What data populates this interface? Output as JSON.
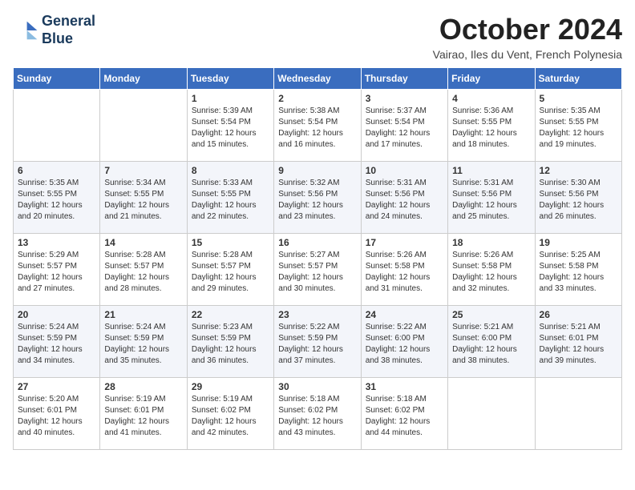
{
  "header": {
    "logo_line1": "General",
    "logo_line2": "Blue",
    "month": "October 2024",
    "location": "Vairao, Iles du Vent, French Polynesia"
  },
  "weekdays": [
    "Sunday",
    "Monday",
    "Tuesday",
    "Wednesday",
    "Thursday",
    "Friday",
    "Saturday"
  ],
  "weeks": [
    [
      {
        "day": "",
        "sunrise": "",
        "sunset": "",
        "daylight": ""
      },
      {
        "day": "",
        "sunrise": "",
        "sunset": "",
        "daylight": ""
      },
      {
        "day": "1",
        "sunrise": "Sunrise: 5:39 AM",
        "sunset": "Sunset: 5:54 PM",
        "daylight": "Daylight: 12 hours and 15 minutes."
      },
      {
        "day": "2",
        "sunrise": "Sunrise: 5:38 AM",
        "sunset": "Sunset: 5:54 PM",
        "daylight": "Daylight: 12 hours and 16 minutes."
      },
      {
        "day": "3",
        "sunrise": "Sunrise: 5:37 AM",
        "sunset": "Sunset: 5:54 PM",
        "daylight": "Daylight: 12 hours and 17 minutes."
      },
      {
        "day": "4",
        "sunrise": "Sunrise: 5:36 AM",
        "sunset": "Sunset: 5:55 PM",
        "daylight": "Daylight: 12 hours and 18 minutes."
      },
      {
        "day": "5",
        "sunrise": "Sunrise: 5:35 AM",
        "sunset": "Sunset: 5:55 PM",
        "daylight": "Daylight: 12 hours and 19 minutes."
      }
    ],
    [
      {
        "day": "6",
        "sunrise": "Sunrise: 5:35 AM",
        "sunset": "Sunset: 5:55 PM",
        "daylight": "Daylight: 12 hours and 20 minutes."
      },
      {
        "day": "7",
        "sunrise": "Sunrise: 5:34 AM",
        "sunset": "Sunset: 5:55 PM",
        "daylight": "Daylight: 12 hours and 21 minutes."
      },
      {
        "day": "8",
        "sunrise": "Sunrise: 5:33 AM",
        "sunset": "Sunset: 5:55 PM",
        "daylight": "Daylight: 12 hours and 22 minutes."
      },
      {
        "day": "9",
        "sunrise": "Sunrise: 5:32 AM",
        "sunset": "Sunset: 5:56 PM",
        "daylight": "Daylight: 12 hours and 23 minutes."
      },
      {
        "day": "10",
        "sunrise": "Sunrise: 5:31 AM",
        "sunset": "Sunset: 5:56 PM",
        "daylight": "Daylight: 12 hours and 24 minutes."
      },
      {
        "day": "11",
        "sunrise": "Sunrise: 5:31 AM",
        "sunset": "Sunset: 5:56 PM",
        "daylight": "Daylight: 12 hours and 25 minutes."
      },
      {
        "day": "12",
        "sunrise": "Sunrise: 5:30 AM",
        "sunset": "Sunset: 5:56 PM",
        "daylight": "Daylight: 12 hours and 26 minutes."
      }
    ],
    [
      {
        "day": "13",
        "sunrise": "Sunrise: 5:29 AM",
        "sunset": "Sunset: 5:57 PM",
        "daylight": "Daylight: 12 hours and 27 minutes."
      },
      {
        "day": "14",
        "sunrise": "Sunrise: 5:28 AM",
        "sunset": "Sunset: 5:57 PM",
        "daylight": "Daylight: 12 hours and 28 minutes."
      },
      {
        "day": "15",
        "sunrise": "Sunrise: 5:28 AM",
        "sunset": "Sunset: 5:57 PM",
        "daylight": "Daylight: 12 hours and 29 minutes."
      },
      {
        "day": "16",
        "sunrise": "Sunrise: 5:27 AM",
        "sunset": "Sunset: 5:57 PM",
        "daylight": "Daylight: 12 hours and 30 minutes."
      },
      {
        "day": "17",
        "sunrise": "Sunrise: 5:26 AM",
        "sunset": "Sunset: 5:58 PM",
        "daylight": "Daylight: 12 hours and 31 minutes."
      },
      {
        "day": "18",
        "sunrise": "Sunrise: 5:26 AM",
        "sunset": "Sunset: 5:58 PM",
        "daylight": "Daylight: 12 hours and 32 minutes."
      },
      {
        "day": "19",
        "sunrise": "Sunrise: 5:25 AM",
        "sunset": "Sunset: 5:58 PM",
        "daylight": "Daylight: 12 hours and 33 minutes."
      }
    ],
    [
      {
        "day": "20",
        "sunrise": "Sunrise: 5:24 AM",
        "sunset": "Sunset: 5:59 PM",
        "daylight": "Daylight: 12 hours and 34 minutes."
      },
      {
        "day": "21",
        "sunrise": "Sunrise: 5:24 AM",
        "sunset": "Sunset: 5:59 PM",
        "daylight": "Daylight: 12 hours and 35 minutes."
      },
      {
        "day": "22",
        "sunrise": "Sunrise: 5:23 AM",
        "sunset": "Sunset: 5:59 PM",
        "daylight": "Daylight: 12 hours and 36 minutes."
      },
      {
        "day": "23",
        "sunrise": "Sunrise: 5:22 AM",
        "sunset": "Sunset: 5:59 PM",
        "daylight": "Daylight: 12 hours and 37 minutes."
      },
      {
        "day": "24",
        "sunrise": "Sunrise: 5:22 AM",
        "sunset": "Sunset: 6:00 PM",
        "daylight": "Daylight: 12 hours and 38 minutes."
      },
      {
        "day": "25",
        "sunrise": "Sunrise: 5:21 AM",
        "sunset": "Sunset: 6:00 PM",
        "daylight": "Daylight: 12 hours and 38 minutes."
      },
      {
        "day": "26",
        "sunrise": "Sunrise: 5:21 AM",
        "sunset": "Sunset: 6:01 PM",
        "daylight": "Daylight: 12 hours and 39 minutes."
      }
    ],
    [
      {
        "day": "27",
        "sunrise": "Sunrise: 5:20 AM",
        "sunset": "Sunset: 6:01 PM",
        "daylight": "Daylight: 12 hours and 40 minutes."
      },
      {
        "day": "28",
        "sunrise": "Sunrise: 5:19 AM",
        "sunset": "Sunset: 6:01 PM",
        "daylight": "Daylight: 12 hours and 41 minutes."
      },
      {
        "day": "29",
        "sunrise": "Sunrise: 5:19 AM",
        "sunset": "Sunset: 6:02 PM",
        "daylight": "Daylight: 12 hours and 42 minutes."
      },
      {
        "day": "30",
        "sunrise": "Sunrise: 5:18 AM",
        "sunset": "Sunset: 6:02 PM",
        "daylight": "Daylight: 12 hours and 43 minutes."
      },
      {
        "day": "31",
        "sunrise": "Sunrise: 5:18 AM",
        "sunset": "Sunset: 6:02 PM",
        "daylight": "Daylight: 12 hours and 44 minutes."
      },
      {
        "day": "",
        "sunrise": "",
        "sunset": "",
        "daylight": ""
      },
      {
        "day": "",
        "sunrise": "",
        "sunset": "",
        "daylight": ""
      }
    ]
  ]
}
